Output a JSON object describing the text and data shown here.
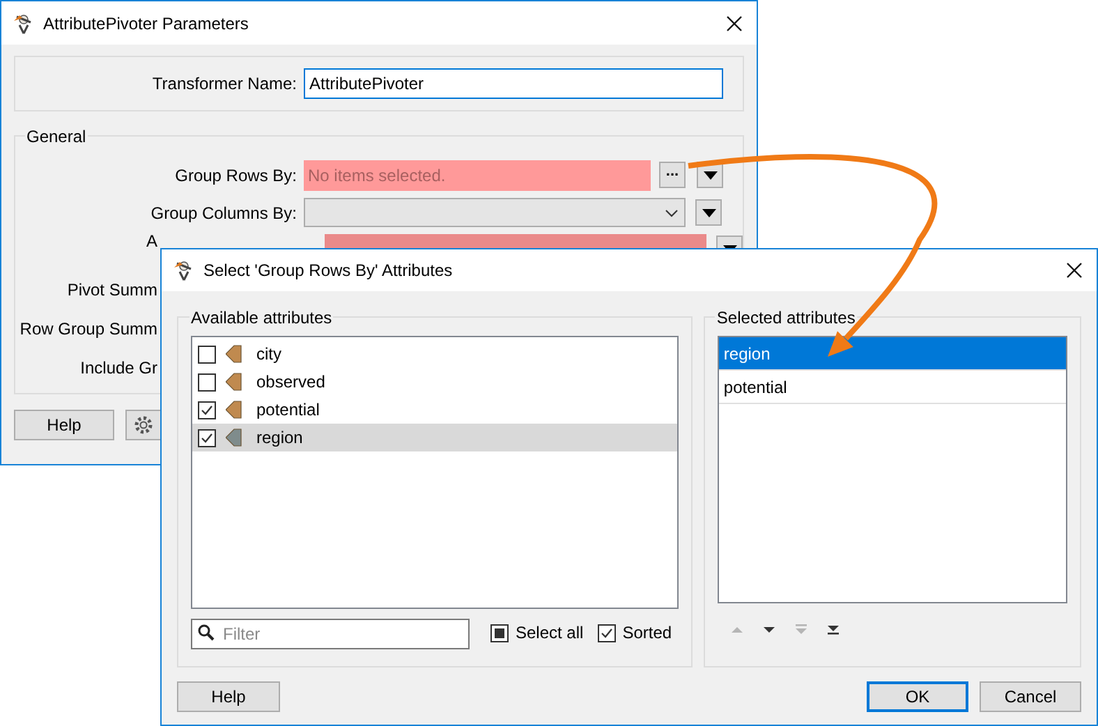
{
  "main_window": {
    "title": "AttributePivoter Parameters",
    "transformer_name": {
      "label": "Transformer Name:",
      "value": "AttributePivoter"
    },
    "general": {
      "title": "General",
      "rows": [
        {
          "label": "Group Rows By:",
          "kind": "list",
          "required": true,
          "placeholder": "No items selected.",
          "button": "..."
        },
        {
          "label": "Group Columns By:",
          "kind": "combo",
          "required": false
        },
        {
          "label": "A",
          "kind": "list",
          "required": true
        },
        {
          "label": "Pivot Summ",
          "kind": "hidden"
        },
        {
          "label": "Row Group Summ",
          "kind": "hidden"
        },
        {
          "label": "Include Gr",
          "kind": "hidden"
        }
      ]
    },
    "help_button": "Help"
  },
  "dialog": {
    "title": "Select 'Group Rows By' Attributes",
    "available": {
      "title": "Available attributes",
      "items": [
        {
          "name": "city",
          "checked": false,
          "selected": false,
          "color": "#c08a4f"
        },
        {
          "name": "observed",
          "checked": false,
          "selected": false,
          "color": "#c08a4f"
        },
        {
          "name": "potential",
          "checked": true,
          "selected": false,
          "color": "#c08a4f"
        },
        {
          "name": "region",
          "checked": true,
          "selected": true,
          "color": "#7f8c8c"
        }
      ],
      "filter": {
        "placeholder": "Filter"
      },
      "select_all": {
        "label": "Select all",
        "partial": true
      },
      "sorted": {
        "label": "Sorted",
        "checked": true
      }
    },
    "selected": {
      "title": "Selected attributes",
      "items": [
        {
          "name": "region",
          "selected": true
        },
        {
          "name": "potential",
          "selected": false
        }
      ],
      "move_buttons": [
        {
          "kind": "up",
          "disabled": true
        },
        {
          "kind": "down",
          "disabled": false
        },
        {
          "kind": "top",
          "disabled": true
        },
        {
          "kind": "bottom",
          "disabled": false
        }
      ]
    },
    "help_button": "Help",
    "ok_button": "OK",
    "cancel_button": "Cancel"
  }
}
